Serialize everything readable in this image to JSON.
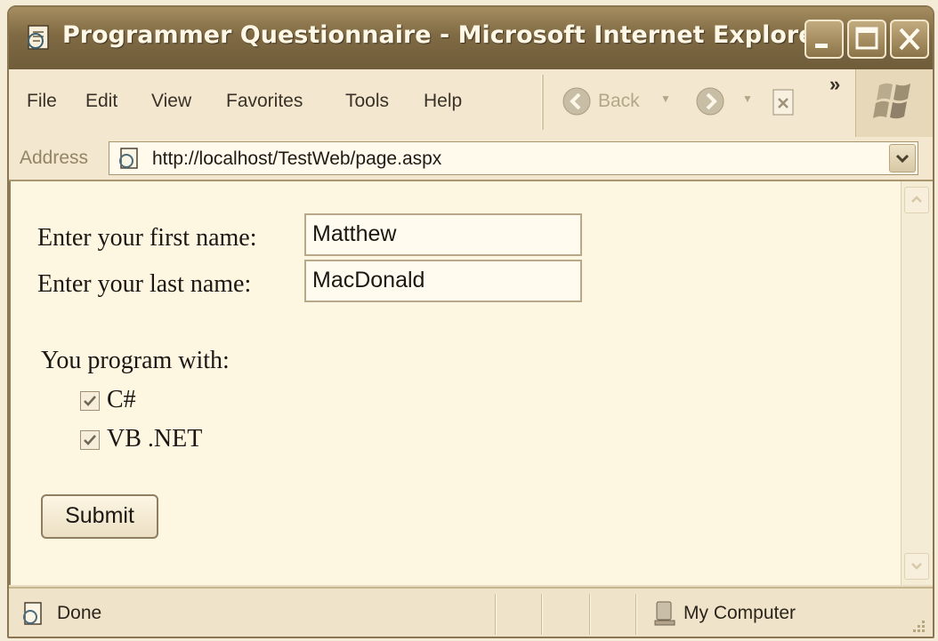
{
  "window": {
    "title": "Programmer Questionnaire - Microsoft Internet Explorer"
  },
  "menu": {
    "items": [
      "File",
      "Edit",
      "View",
      "Favorites",
      "Tools",
      "Help"
    ]
  },
  "toolbar": {
    "back_label": "Back",
    "more_symbol": "»"
  },
  "address": {
    "label": "Address",
    "url": "http://localhost/TestWeb/page.aspx"
  },
  "form": {
    "first_name_label": "Enter your first name:",
    "first_name_value": "Matthew",
    "last_name_label": "Enter your last name:",
    "last_name_value": "MacDonald",
    "languages_label": "You program with:",
    "languages": [
      {
        "label": "C#",
        "checked": true
      },
      {
        "label": "VB .NET",
        "checked": true
      }
    ],
    "submit_label": "Submit"
  },
  "status": {
    "text": "Done",
    "zone": "My Computer"
  },
  "colors": {
    "titlebar": "#7f6a44",
    "page_background": "#fdf7e2",
    "chrome": "#f3e8cf"
  }
}
